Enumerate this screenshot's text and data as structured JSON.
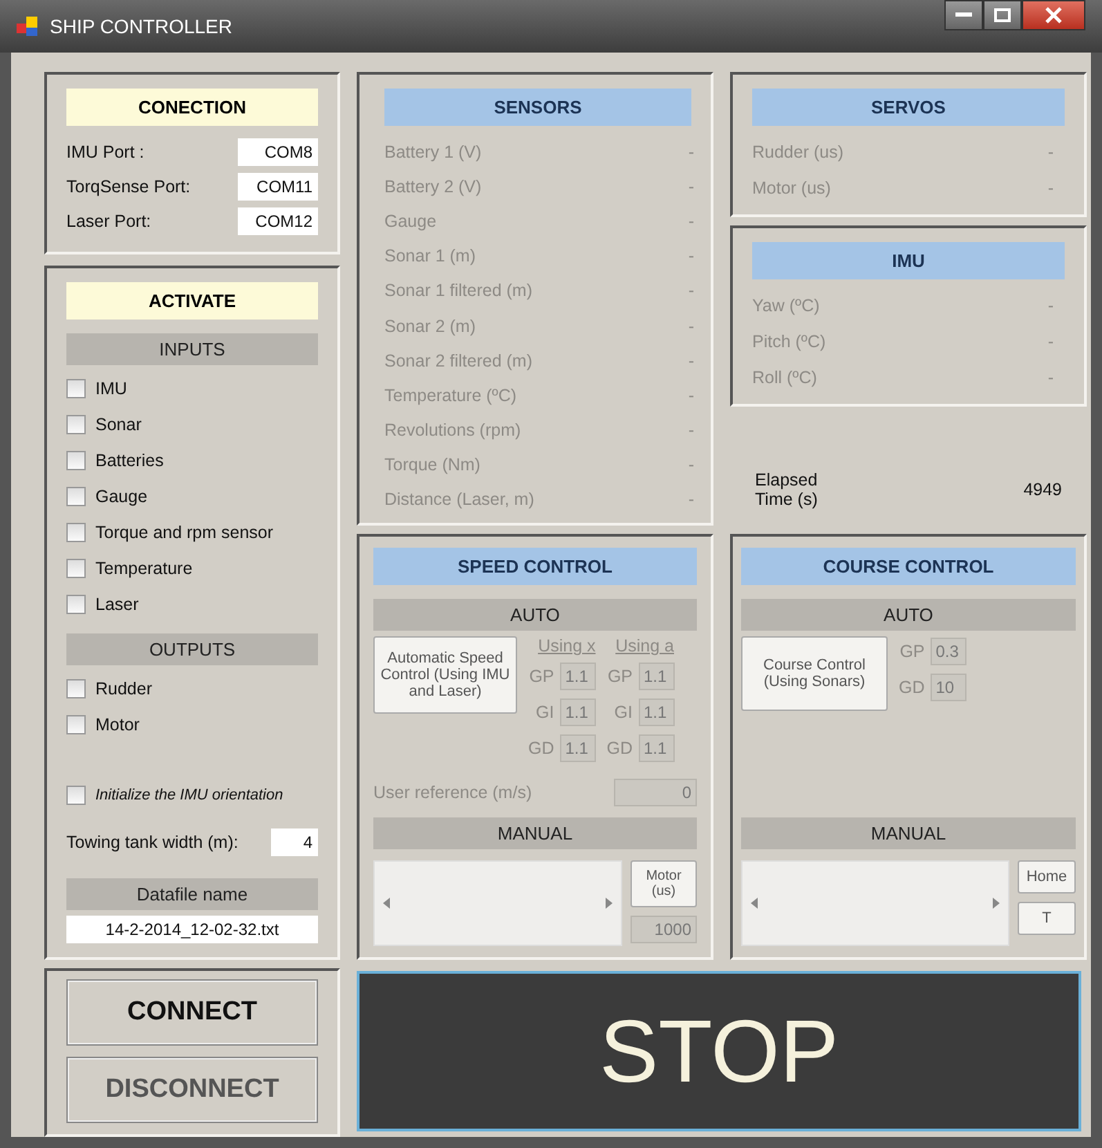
{
  "window": {
    "title": "SHIP CONTROLLER"
  },
  "connection": {
    "title": "CONECTION",
    "ports": [
      {
        "label": "IMU Port :",
        "value": "COM8"
      },
      {
        "label": "TorqSense Port:",
        "value": "COM11"
      },
      {
        "label": "Laser Port:",
        "value": "COM12"
      }
    ]
  },
  "activate": {
    "title": "ACTIVATE",
    "groups": [
      {
        "title": "INPUTS",
        "items": [
          {
            "label": "IMU",
            "checked": false
          },
          {
            "label": "Sonar",
            "checked": false
          },
          {
            "label": "Batteries",
            "checked": false
          },
          {
            "label": "Gauge",
            "checked": false
          },
          {
            "label": "Torque and rpm sensor",
            "checked": false
          },
          {
            "label": "Temperature",
            "checked": false
          },
          {
            "label": "Laser",
            "checked": false
          }
        ]
      },
      {
        "title": "OUTPUTS",
        "items": [
          {
            "label": "Rudder",
            "checked": false
          },
          {
            "label": "Motor",
            "checked": false
          }
        ]
      }
    ],
    "init": {
      "label": "Initialize the IMU orientation",
      "checked": false
    },
    "tank": {
      "label": "Towing tank width (m):",
      "value": "4"
    },
    "datafile": {
      "title": "Datafile name",
      "value": "14-2-2014_12-02-32.txt"
    }
  },
  "sensors": {
    "title": "SENSORS",
    "rows": [
      {
        "label": "Battery 1 (V)",
        "value": "-"
      },
      {
        "label": "Battery 2 (V)",
        "value": "-"
      },
      {
        "label": "Gauge",
        "value": "-"
      },
      {
        "label": "Sonar 1 (m)",
        "value": "-"
      },
      {
        "label": "Sonar 1 filtered (m)",
        "value": "-"
      },
      {
        "label": "Sonar 2 (m)",
        "value": "-"
      },
      {
        "label": "Sonar 2 filtered (m)",
        "value": "-"
      },
      {
        "label": "Temperature (ºC)",
        "value": "-"
      },
      {
        "label": "Revolutions (rpm)",
        "value": "-"
      },
      {
        "label": "Torque (Nm)",
        "value": "-"
      },
      {
        "label": "Distance (Laser, m)",
        "value": "-"
      }
    ]
  },
  "servos": {
    "title": "SERVOS",
    "rows": [
      {
        "label": "Rudder (us)",
        "value": "-"
      },
      {
        "label": "Motor (us)",
        "value": "-"
      }
    ]
  },
  "imu": {
    "title": "IMU",
    "rows": [
      {
        "label": "Yaw (ºC)",
        "value": "-"
      },
      {
        "label": "Pitch (ºC)",
        "value": "-"
      },
      {
        "label": "Roll (ºC)",
        "value": "-"
      }
    ]
  },
  "elapsed": {
    "label": "Elapsed Time (s)",
    "value": "4949"
  },
  "speed_control": {
    "title": "SPEED CONTROL",
    "auto": {
      "title": "AUTO",
      "button": "Automatic Speed Control (Using IMU and Laser)",
      "columns": [
        {
          "title": "Using x",
          "gains": [
            {
              "label": "GP",
              "value": "1.1"
            },
            {
              "label": "GI",
              "value": "1.1"
            },
            {
              "label": "GD",
              "value": "1.1"
            }
          ]
        },
        {
          "title": "Using a",
          "gains": [
            {
              "label": "GP",
              "value": "1.1"
            },
            {
              "label": "GI",
              "value": "1.1"
            },
            {
              "label": "GD",
              "value": "1.1"
            }
          ]
        }
      ]
    },
    "user_reference": {
      "label": "User reference (m/s)",
      "value": "0"
    },
    "manual": {
      "title": "MANUAL",
      "button": "Motor (us)",
      "value": "1000"
    }
  },
  "course_control": {
    "title": "COURSE CONTROL",
    "auto": {
      "title": "AUTO",
      "button": "Course Control (Using Sonars)",
      "gains": [
        {
          "label": "GP",
          "value": "0.3"
        },
        {
          "label": "GD",
          "value": "10"
        }
      ]
    },
    "manual": {
      "title": "MANUAL",
      "buttons": [
        "Home",
        "T"
      ]
    }
  },
  "buttons": [
    {
      "label": "CONNECT",
      "disabled": false
    },
    {
      "label": "DISCONNECT",
      "disabled": true
    }
  ],
  "stop": {
    "label": "STOP"
  }
}
